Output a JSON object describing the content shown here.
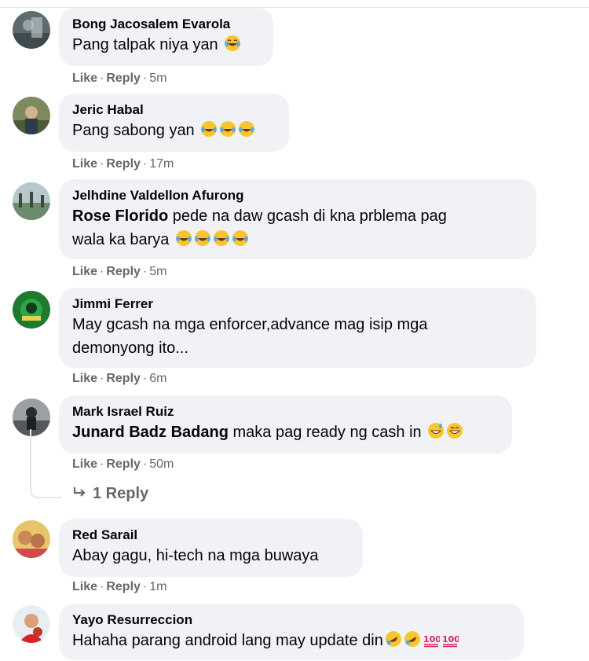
{
  "comments": [
    {
      "name": "Bong Jacosalem Evarola",
      "mention": "",
      "text": "Pang talpak niya yan",
      "emojis": [
        "laugh-cry"
      ],
      "time": "5m"
    },
    {
      "name": "Jeric Habal",
      "mention": "",
      "text": "Pang sabong yan",
      "emojis": [
        "laugh-cry",
        "laugh-cry",
        "laugh-cry"
      ],
      "time": "17m"
    },
    {
      "name": "Jelhdine Valdellon Afurong",
      "mention": "Rose Florido",
      "text": "pede na daw gcash di kna prblema pag",
      "text2": "wala ka barya",
      "emojis": [
        "laugh-cry",
        "laugh-cry",
        "laugh-cry",
        "laugh-cry"
      ],
      "time": "5m"
    },
    {
      "name": "Jimmi Ferrer",
      "mention": "",
      "text": "May gcash na mga enforcer,advance mag isip mga",
      "text2": "demonyong ito...",
      "emojis": [],
      "time": "6m"
    },
    {
      "name": "Mark Israel Ruiz",
      "mention": "Junard Badz Badang",
      "text": "maka pag ready ng cash in",
      "emojis": [
        "grin-sweat",
        "grin"
      ],
      "time": "50m"
    },
    {
      "name": "Red Sarail",
      "mention": "",
      "text": "Abay gagu, hi-tech na mga buwaya",
      "emojis": [],
      "time": "1m"
    },
    {
      "name": "Yayo Resurreccion",
      "mention": "",
      "text": "Hahaha parang android lang may update din",
      "emojis": [
        "rofl",
        "rofl",
        "hundred",
        "hundred"
      ],
      "time": ""
    }
  ],
  "actions": {
    "like": "Like",
    "reply": "Reply",
    "dot": "·"
  },
  "replies_label": "1 Reply",
  "colors": {
    "bubble": "#f0f2f5",
    "meta": "#65676b",
    "text": "#050505"
  }
}
